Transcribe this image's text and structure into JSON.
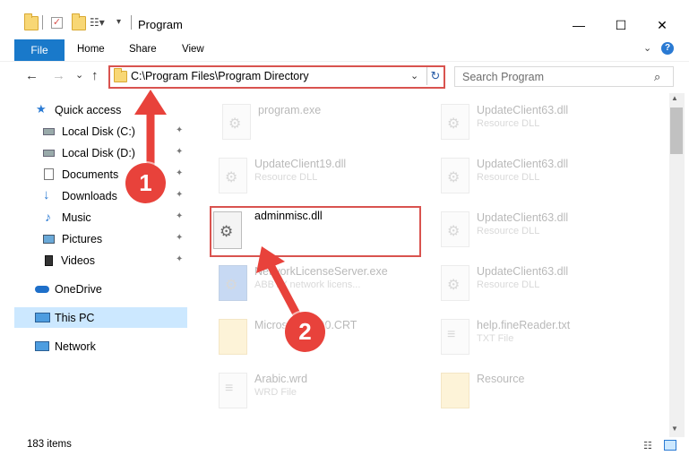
{
  "window": {
    "title": "Program",
    "minimize_glyph": "—",
    "maximize_glyph": "☐",
    "close_glyph": "✕"
  },
  "ribbon": {
    "tabs": [
      "File",
      "Home",
      "Share",
      "View"
    ],
    "help_glyph": "?",
    "expand_glyph": "⌄"
  },
  "nav": {
    "back_glyph": "←",
    "forward_glyph": "→",
    "recent_glyph": "⌄",
    "up_glyph": "↑",
    "address": "C:\\Program Files\\Program Directory",
    "address_dropdown_glyph": "⌄",
    "refresh_glyph": "↻",
    "search_placeholder": "Search Program",
    "search_glyph": "⌕"
  },
  "sidebar": {
    "items": [
      {
        "label": "Quick access",
        "icon": "star-icon"
      },
      {
        "label": "Local Disk (C:)",
        "icon": "drive-icon",
        "pinned": true
      },
      {
        "label": "Local Disk (D:)",
        "icon": "drive-icon",
        "pinned": true
      },
      {
        "label": "Documents",
        "icon": "documents-icon",
        "pinned": true
      },
      {
        "label": "Downloads",
        "icon": "download-icon",
        "pinned": true
      },
      {
        "label": "Music",
        "icon": "music-icon",
        "pinned": true
      },
      {
        "label": "Pictures",
        "icon": "pictures-icon",
        "pinned": true
      },
      {
        "label": "Videos",
        "icon": "videos-icon",
        "pinned": true
      },
      {
        "label": "OneDrive",
        "icon": "cloud-icon"
      },
      {
        "label": "This PC",
        "icon": "computer-icon",
        "selected": true
      },
      {
        "label": "Network",
        "icon": "network-icon"
      }
    ],
    "pin_glyph": "📌"
  },
  "files": [
    {
      "name": "program.exe",
      "type": ""
    },
    {
      "name": "UpdateClient63.dll",
      "type": "Resource DLL"
    },
    {
      "name": "UpdateClient19.dll",
      "type": "Resource DLL"
    },
    {
      "name": "UpdateClient63.dll",
      "type": "Resource DLL"
    },
    {
      "name": "adminmisc.dll",
      "type": ""
    },
    {
      "name": "UpdateClient63.dll",
      "type": "Resource DLL"
    },
    {
      "name": "NetworkLicenseServer.exe",
      "type": "ABBYY network licens..."
    },
    {
      "name": "UpdateClient63.dll",
      "type": "Resource DLL"
    },
    {
      "name": "Microsoft.VC90.CRT",
      "type": ""
    },
    {
      "name": "help.fineReader.txt",
      "type": "TXT File"
    },
    {
      "name": "Arabic.wrd",
      "type": "WRD File"
    },
    {
      "name": "Resource",
      "type": ""
    }
  ],
  "status": {
    "items_count": "183 items",
    "details_view_glyph": "☷"
  },
  "annotations": {
    "step1": "1",
    "step2": "2"
  },
  "colors": {
    "accent": "#1979ca",
    "highlight_border": "#d9534f",
    "badge": "#e8423b",
    "selection": "#cce8ff"
  }
}
